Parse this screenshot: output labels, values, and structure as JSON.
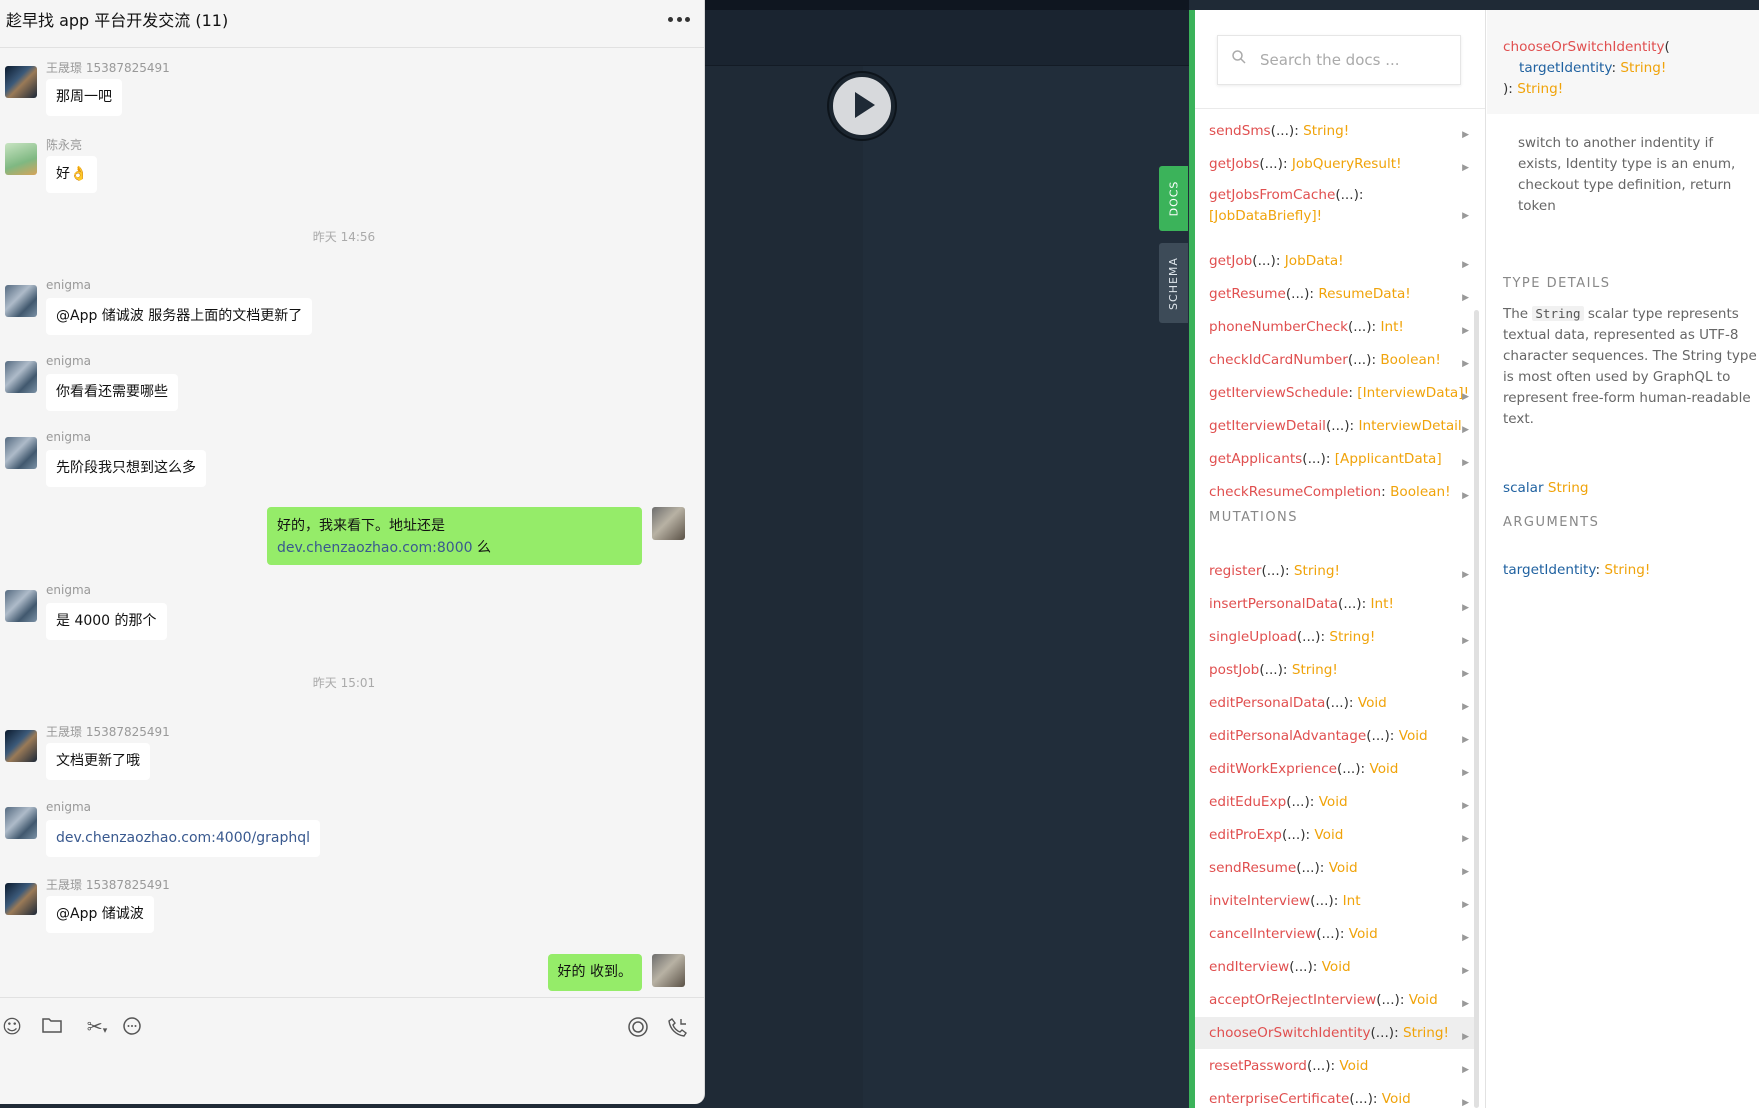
{
  "chat": {
    "title": "趁早找 app 平台开发交流 (11)",
    "messages": [
      {
        "sender": "王晟璟 15387825491",
        "text": "那周一吧"
      },
      {
        "sender": "陈永亮",
        "text": "好👌"
      },
      {
        "sender": "enigma",
        "text": "@App 储诚波 服务器上面的文档更新了"
      },
      {
        "sender": "enigma",
        "text": "你看看还需要哪些"
      },
      {
        "sender": "enigma",
        "text": "先阶段我只想到这么多"
      },
      {
        "sender": "enigma",
        "text": "是 4000 的那个"
      },
      {
        "sender": "王晟璟 15387825491",
        "text": "文档更新了哦"
      },
      {
        "sender": "enigma",
        "text": "dev.chenzaozhao.com:4000/graphql"
      },
      {
        "sender": "王晟璟 15387825491",
        "text": "@App 储诚波"
      }
    ],
    "time1": "昨天 14:56",
    "time2": "昨天 15:01",
    "self_long_prefix": "好的，我来看下。地址还是 ",
    "self_long_link": "dev.chenzaozhao.com:8000",
    "self_long_suffix": " 么",
    "self_short": "好的  收到。",
    "toolbar_icons": [
      "emoji-icon",
      "folder-icon",
      "scissors-icon",
      "chat-history-icon",
      "live-icon",
      "call-icon"
    ]
  },
  "tabs": {
    "docs": "DOCS",
    "schema": "SCHEMA"
  },
  "docs": {
    "search_placeholder": "Search the docs ...",
    "queries": [
      {
        "name": "sendSms",
        "args": "(...)",
        "type": "String!"
      },
      {
        "name": "getJobs",
        "args": "(...)",
        "type": "JobQueryResult!"
      },
      {
        "name": "getJobsFromCache",
        "args": "(...)",
        "type": "[JobDataBriefly]!"
      },
      {
        "name": "getJob",
        "args": "(...)",
        "type": "JobData!"
      },
      {
        "name": "getResume",
        "args": "(...)",
        "type": "ResumeData!"
      },
      {
        "name": "phoneNumberCheck",
        "args": "(...)",
        "type": "Int!"
      },
      {
        "name": "checkIdCardNumber",
        "args": "(...)",
        "type": "Boolean!"
      },
      {
        "name": "getIterviewSchedule",
        "args": "",
        "type": "[InterviewData]!"
      },
      {
        "name": "getIterviewDetail",
        "args": "(...)",
        "type": "InterviewDetail"
      },
      {
        "name": "getApplicants",
        "args": "(...)",
        "type": "[ApplicantData]"
      },
      {
        "name": "checkResumeCompletion",
        "args": "",
        "type": "Boolean!"
      }
    ],
    "mutations_title": "MUTATIONS",
    "mutations": [
      {
        "name": "register",
        "args": "(...)",
        "type": "String!"
      },
      {
        "name": "insertPersonalData",
        "args": "(...)",
        "type": "Int!"
      },
      {
        "name": "singleUpload",
        "args": "(...)",
        "type": "String!"
      },
      {
        "name": "postJob",
        "args": "(...)",
        "type": "String!"
      },
      {
        "name": "editPersonalData",
        "args": "(...)",
        "type": "Void"
      },
      {
        "name": "editPersonalAdvantage",
        "args": "(...)",
        "type": "Void"
      },
      {
        "name": "editWorkExprience",
        "args": "(...)",
        "type": "Void"
      },
      {
        "name": "editEduExp",
        "args": "(...)",
        "type": "Void"
      },
      {
        "name": "editProExp",
        "args": "(...)",
        "type": "Void"
      },
      {
        "name": "sendResume",
        "args": "(...)",
        "type": "Void"
      },
      {
        "name": "inviteInterview",
        "args": "(...)",
        "type": "Int"
      },
      {
        "name": "cancelInterview",
        "args": "(...)",
        "type": "Void"
      },
      {
        "name": "endIterview",
        "args": "(...)",
        "type": "Void"
      },
      {
        "name": "acceptOrRejectInterview",
        "args": "(...)",
        "type": "Void"
      },
      {
        "name": "chooseOrSwitchIdentity",
        "args": "(...)",
        "type": "String!"
      },
      {
        "name": "resetPassword",
        "args": "(...)",
        "type": "Void"
      },
      {
        "name": "enterpriseCertificate",
        "args": "(...)",
        "type": "Void"
      }
    ],
    "selected_field": "chooseOrSwitchIdentity"
  },
  "detail": {
    "sig_name": "chooseOrSwitchIdentity",
    "sig_open": "(",
    "sig_arg": "targetIdentity",
    "sig_arg_type": "String!",
    "sig_close": "):",
    "sig_return": "String!",
    "description": "switch to another indentity if exists, Identity type is an enum, checkout type definition, return token",
    "type_details_title": "TYPE DETAILS",
    "type_desc_prefix": "The",
    "type_desc_code": "String",
    "type_desc_rest": "scalar type represents textual data, represented as UTF-8 character sequences. The String type is most often used by GraphQL to represent free-form human-readable text.",
    "scalar_kw": "scalar",
    "scalar_type": "String",
    "arguments_title": "ARGUMENTS",
    "arg_name": "targetIdentity",
    "arg_type": "String!"
  }
}
